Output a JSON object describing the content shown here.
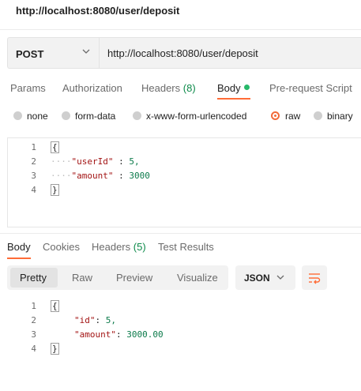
{
  "request": {
    "title": "http://localhost:8080/user/deposit",
    "method": "POST",
    "url": "http://localhost:8080/user/deposit"
  },
  "request_tabs": {
    "params": "Params",
    "authorization": "Authorization",
    "headers": "Headers",
    "headers_count": "(8)",
    "body": "Body",
    "prerequest": "Pre-request Script"
  },
  "body_types": {
    "none": "none",
    "form_data": "form-data",
    "urlencoded": "x-www-form-urlencoded",
    "raw": "raw",
    "binary": "binary"
  },
  "request_body": {
    "line_numbers": [
      "1",
      "2",
      "3",
      "4"
    ],
    "open_brace": "{",
    "key1": "\"userId\"",
    "val1": "5,",
    "key2": "\"amount\"",
    "val2": "3000",
    "close_brace": "}",
    "colon": ":",
    "indent": "····"
  },
  "response_tabs": {
    "body": "Body",
    "cookies": "Cookies",
    "headers": "Headers",
    "headers_count": "(5)",
    "test_results": "Test Results"
  },
  "view_modes": {
    "pretty": "Pretty",
    "raw": "Raw",
    "preview": "Preview",
    "visualize": "Visualize",
    "format": "JSON"
  },
  "response_body": {
    "line_numbers": [
      "1",
      "2",
      "3",
      "4"
    ],
    "open_brace": "{",
    "key1": "\"id\"",
    "val1": "5,",
    "key2": "\"amount\"",
    "val2": "3000.00",
    "close_brace": "}",
    "colon": ":"
  },
  "colors": {
    "accent": "#ff6c37",
    "count_green": "#0d8a4a",
    "dot_green": "#27b96a"
  }
}
